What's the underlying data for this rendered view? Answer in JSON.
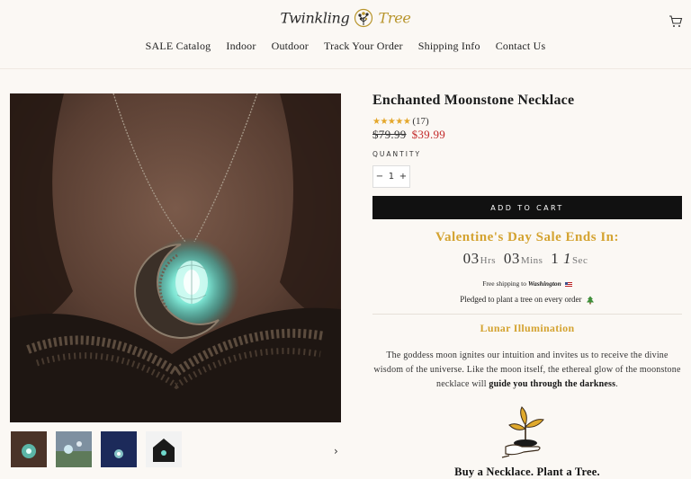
{
  "header": {
    "logo_part1": "Twinkling",
    "logo_part2": "Tree",
    "cart_icon": "cart-icon"
  },
  "nav": {
    "items": [
      "SALE Catalog",
      "Indoor",
      "Outdoor",
      "Track Your Order",
      "Shipping Info",
      "Contact Us"
    ]
  },
  "gallery": {
    "thumbnail_count": 4,
    "next_arrow": "›"
  },
  "product": {
    "title": "Enchanted Moonstone Necklace",
    "stars": "★★★★★",
    "rating_count": "(17)",
    "rating_value": 5,
    "old_price": "$79.99",
    "new_price": "$39.99",
    "quantity_label": "QUANTITY",
    "quantity_minus": "−",
    "quantity_value": "1",
    "quantity_plus": "+",
    "add_to_cart": "ADD TO CART"
  },
  "sale": {
    "title": "Valentine's Day Sale Ends In:",
    "hours": "03",
    "hours_label": "Hrs",
    "mins": "03",
    "mins_label": "Mins",
    "secs_a": "1",
    "secs_b": "1",
    "secs_label": "Sec"
  },
  "shipping": {
    "prefix": "Free shipping to",
    "location": "Washington"
  },
  "pledge": {
    "text": "Pledged to plant a tree on every order"
  },
  "details": {
    "subheading": "Lunar Illumination",
    "desc_part1": "The goddess moon ignites our intuition and invites us to receive the divine wisdom of the universe. Like the moon itself, the ethereal glow of the moonstone necklace will ",
    "desc_bold": "guide you through the darkness",
    "desc_end": ".",
    "tagline": "Buy a Necklace. Plant a Tree."
  },
  "colors": {
    "accent_gold": "#d4a331",
    "sale_red": "#c32a2a",
    "button_black": "#111111",
    "background": "#fbf8f4"
  }
}
